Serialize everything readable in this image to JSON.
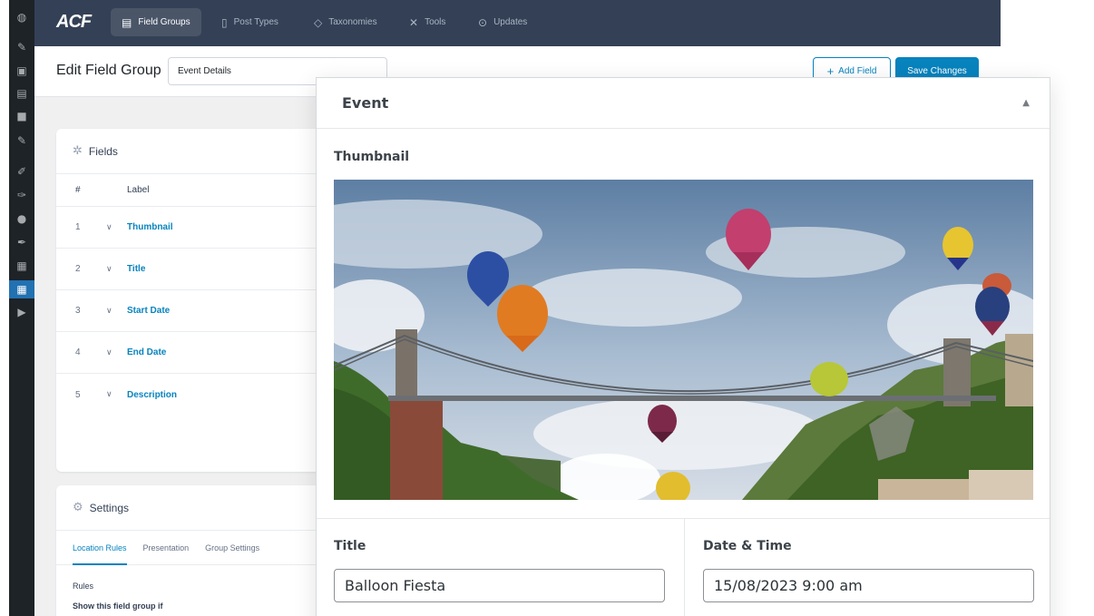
{
  "wp_sidebar": {
    "icons": [
      "dashboard-icon",
      "pin-icon",
      "media-icon",
      "pages-icon",
      "comments-icon",
      "pin-icon",
      "appearance-icon",
      "plugins-icon",
      "users-icon",
      "tools-icon",
      "settings-icon",
      "acf-icon",
      "play-icon"
    ]
  },
  "acf_bar": {
    "logo": "ACF",
    "tabs": [
      {
        "label": "Field Groups",
        "icon": "list-icon",
        "active": true
      },
      {
        "label": "Post Types",
        "icon": "document-icon",
        "active": false
      },
      {
        "label": "Taxonomies",
        "icon": "tag-icon",
        "active": false
      },
      {
        "label": "Tools",
        "icon": "wrench-icon",
        "active": false
      },
      {
        "label": "Updates",
        "icon": "download-icon",
        "active": false
      }
    ]
  },
  "header": {
    "title": "Edit Field Group",
    "group_name": "Event Details",
    "add_field_label": "Add Field",
    "save_label": "Save Changes"
  },
  "fields_card": {
    "title": "Fields",
    "columns": {
      "num": "#",
      "label": "Label"
    },
    "rows": [
      {
        "num": "1",
        "label": "Thumbnail"
      },
      {
        "num": "2",
        "label": "Title"
      },
      {
        "num": "3",
        "label": "Start Date"
      },
      {
        "num": "4",
        "label": "End Date"
      },
      {
        "num": "5",
        "label": "Description"
      }
    ]
  },
  "settings_card": {
    "title": "Settings",
    "tabs": [
      "Location Rules",
      "Presentation",
      "Group Settings"
    ],
    "rules_label": "Rules",
    "rules_text": "Show this field group if"
  },
  "event_panel": {
    "title": "Event",
    "thumbnail_label": "Thumbnail",
    "title_label": "Title",
    "title_value": "Balloon Fiesta",
    "datetime_label": "Date & Time",
    "datetime_value": "15/08/2023 9:00 am"
  },
  "colors": {
    "acf_bar": "#344055",
    "accent": "#0783be",
    "wp_sidebar": "#1d2327",
    "background": "#f0f0f1"
  }
}
